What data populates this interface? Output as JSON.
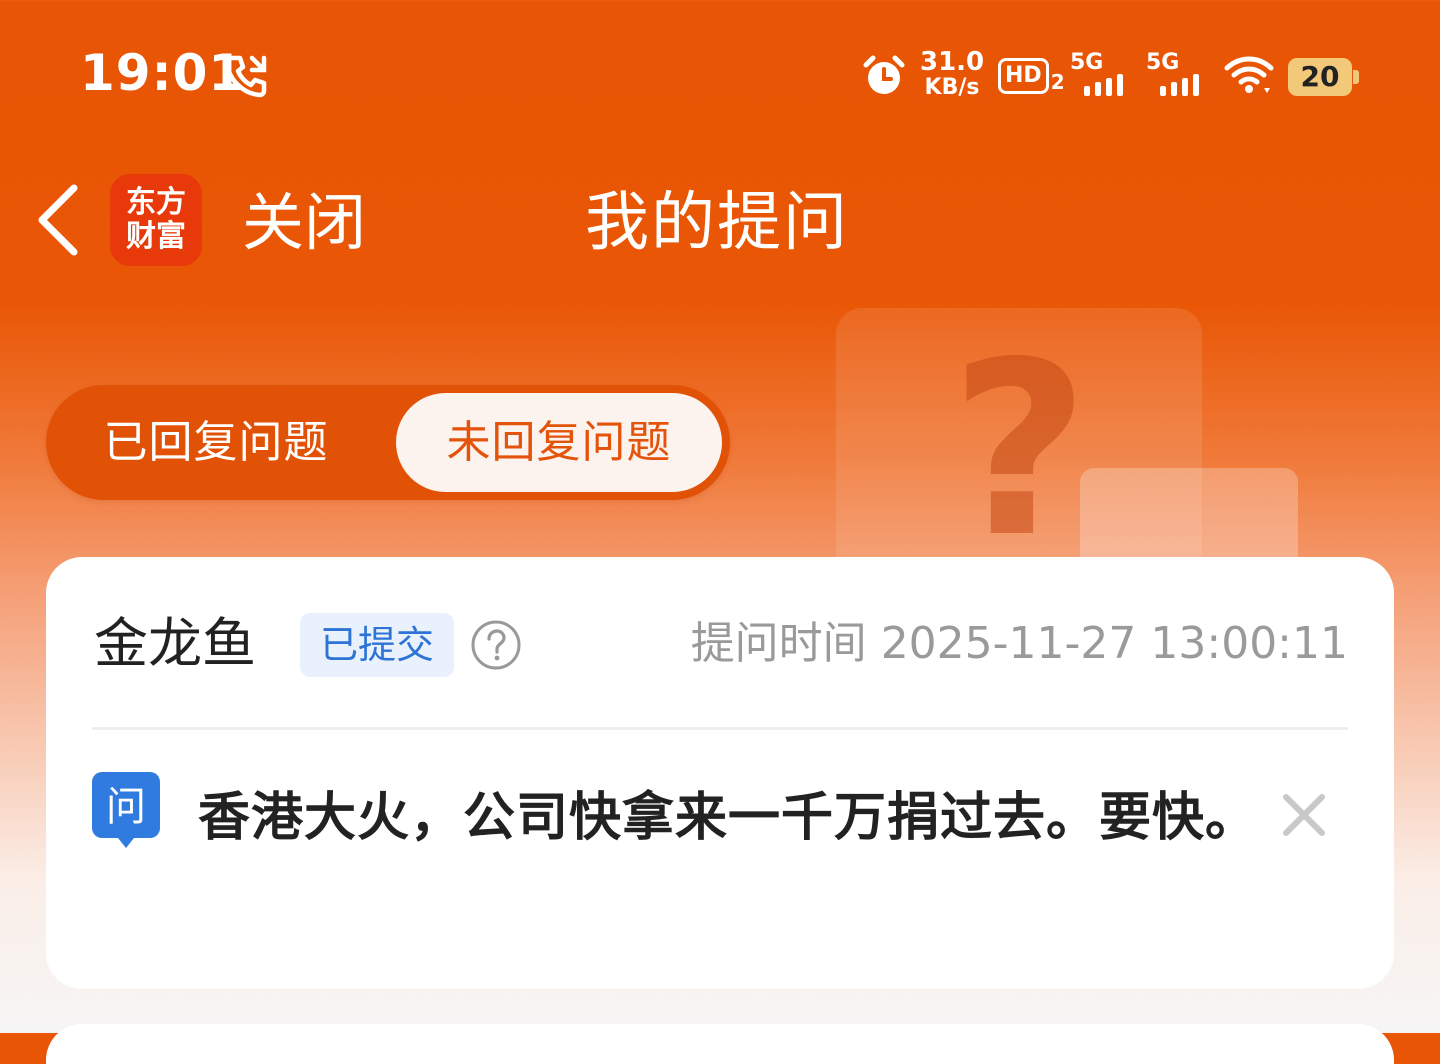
{
  "status_bar": {
    "time": "19:01",
    "net_speed_value": "31.0",
    "net_speed_unit": "KB/s",
    "hd_label": "HD",
    "hd_sub": "2",
    "sim1_label": "5G",
    "sim2_label": "5G",
    "battery": "20",
    "icons": [
      "phone-call-icon",
      "alarm-icon",
      "hd-icon",
      "signal-icon",
      "signal-icon",
      "wifi-icon",
      "battery-icon"
    ]
  },
  "nav": {
    "back_icon": "chevron-left-icon",
    "logo_line1": "东方",
    "logo_line2": "财富",
    "close_label": "关闭",
    "title": "我的提问"
  },
  "tabs": [
    {
      "label": "已回复问题",
      "active": false
    },
    {
      "label": "未回复问题",
      "active": true
    }
  ],
  "question_card": {
    "company": "金龙鱼",
    "status": "已提交",
    "help_icon": "question-circle-icon",
    "time_label": "提问时间",
    "time_value": "2025-11-27 13:00:11",
    "question_badge": "问",
    "question_text": "香港大火，公司快拿来一千万捐过去。要快。",
    "delete_icon": "close-icon"
  },
  "colors": {
    "brand_orange": "#e85504",
    "tab_active_text": "#e3530a",
    "badge_blue": "#2e74d6",
    "badge_bg": "#e8f1fc"
  }
}
